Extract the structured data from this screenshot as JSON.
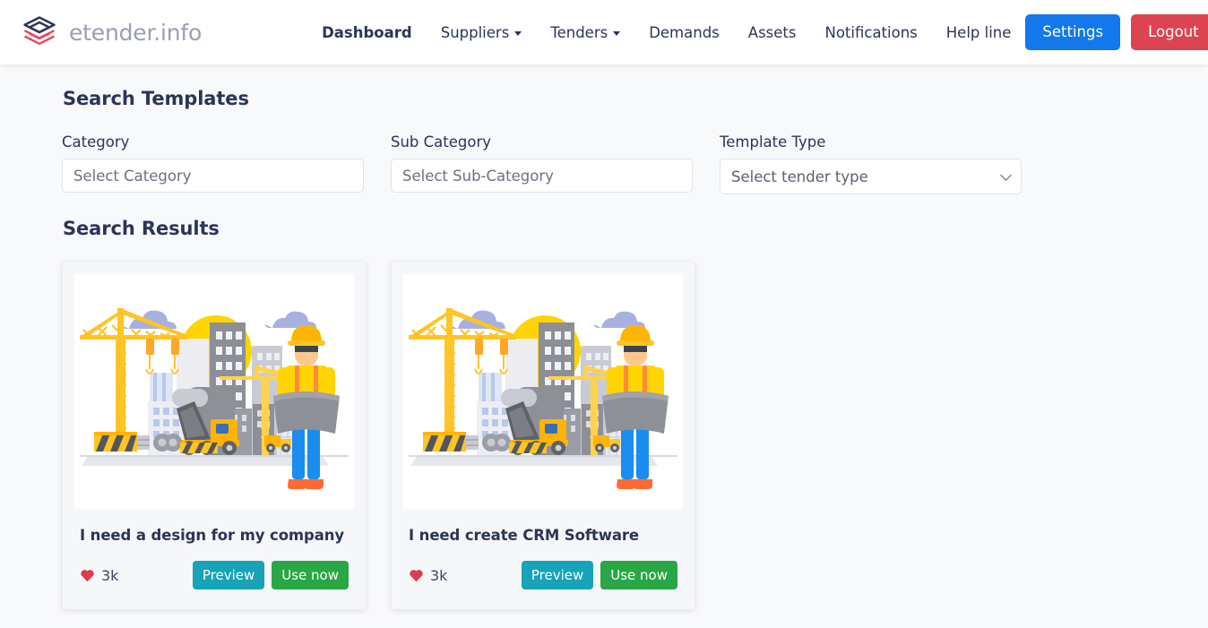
{
  "brand": {
    "name": "etender.info",
    "logo_icon": "stacked-layers-logo"
  },
  "nav": {
    "items": [
      {
        "label": "Dashboard",
        "active": true,
        "has_dropdown": false
      },
      {
        "label": "Suppliers",
        "active": false,
        "has_dropdown": true
      },
      {
        "label": "Tenders",
        "active": false,
        "has_dropdown": true
      },
      {
        "label": "Demands",
        "active": false,
        "has_dropdown": false
      },
      {
        "label": "Assets",
        "active": false,
        "has_dropdown": false
      },
      {
        "label": "Notifications",
        "active": false,
        "has_dropdown": false
      },
      {
        "label": "Help line",
        "active": false,
        "has_dropdown": false
      }
    ],
    "settings_label": "Settings",
    "logout_label": "Logout"
  },
  "search": {
    "title": "Search Templates",
    "fields": {
      "category": {
        "label": "Category",
        "placeholder": "Select Category",
        "value": ""
      },
      "sub_category": {
        "label": "Sub Category",
        "placeholder": "Select Sub-Category",
        "value": ""
      },
      "template_type": {
        "label": "Template Type",
        "selected": "Select tender type",
        "options": [
          "Select tender type"
        ]
      }
    }
  },
  "results": {
    "title": "Search Results",
    "cards": [
      {
        "title": "I need a design for my company",
        "likes": "3k",
        "like_icon": "heart-icon",
        "image_alt": "construction-site-illustration",
        "preview_label": "Preview",
        "use_label": "Use now"
      },
      {
        "title": "I need create CRM Software",
        "likes": "3k",
        "like_icon": "heart-icon",
        "image_alt": "construction-site-illustration",
        "preview_label": "Preview",
        "use_label": "Use now"
      }
    ]
  },
  "colors": {
    "brand_navy": "#2c3557",
    "brand_red": "#e8455a",
    "settings_blue": "#1278ec",
    "logout_red": "#dc4452",
    "preview_teal": "#17a3b8",
    "use_green": "#29a745",
    "heart_red": "#dc3c51",
    "page_bg": "#f8f9fb"
  }
}
